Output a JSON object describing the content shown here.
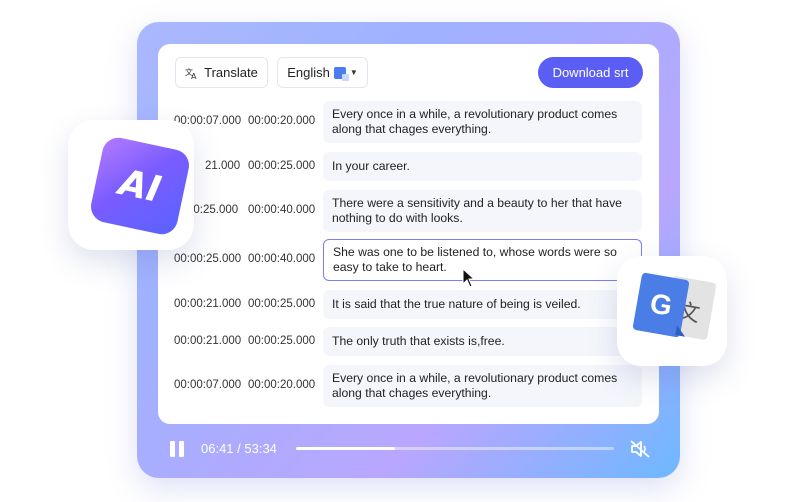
{
  "toolbar": {
    "translate_label": "Translate",
    "language_label": "English",
    "download_label": "Download srt"
  },
  "subtitles": [
    {
      "start": "00:00:07.000",
      "end": "00:00:20.000",
      "text": "Every once in a while, a revolutionary product comes along that chages everything.",
      "active": false
    },
    {
      "start": "21.000",
      "end": "00:00:25.000",
      "text": "In your career.",
      "active": false
    },
    {
      "start": "00:25.000",
      "end": "00:00:40.000",
      "text": "There were a sensitivity and a beauty to her that have nothing to do with looks.",
      "active": false
    },
    {
      "start": "00:00:25.000",
      "end": "00:00:40.000",
      "text": "She was one to be listened to, whose words were so easy to take to heart.",
      "active": true
    },
    {
      "start": "00:00:21.000",
      "end": "00:00:25.000",
      "text": "It is said that the true nature of being is veiled.",
      "active": false
    },
    {
      "start": "00:00:21.000",
      "end": "00:00:25.000",
      "text": "The only truth that exists is,free.",
      "active": false
    },
    {
      "start": "00:00:07.000",
      "end": "00:00:20.000",
      "text": "Every once in a while, a revolutionary product comes along that chages everything.",
      "active": false
    }
  ],
  "player": {
    "current": "06:41",
    "total": "53:34",
    "time_display": "06:41 / 53:34",
    "progress": 0.31
  },
  "badges": {
    "ai_label": "AI",
    "google_label": "G",
    "translate_glyph": "文"
  },
  "colors": {
    "accent": "#5b5ef5",
    "active_border": "#7b7ef3"
  },
  "icons": [
    "translate-icon",
    "language-icon",
    "caret-down-icon",
    "pause-icon",
    "mute-icon",
    "cursor-icon",
    "ai-icon",
    "google-translate-icon"
  ]
}
